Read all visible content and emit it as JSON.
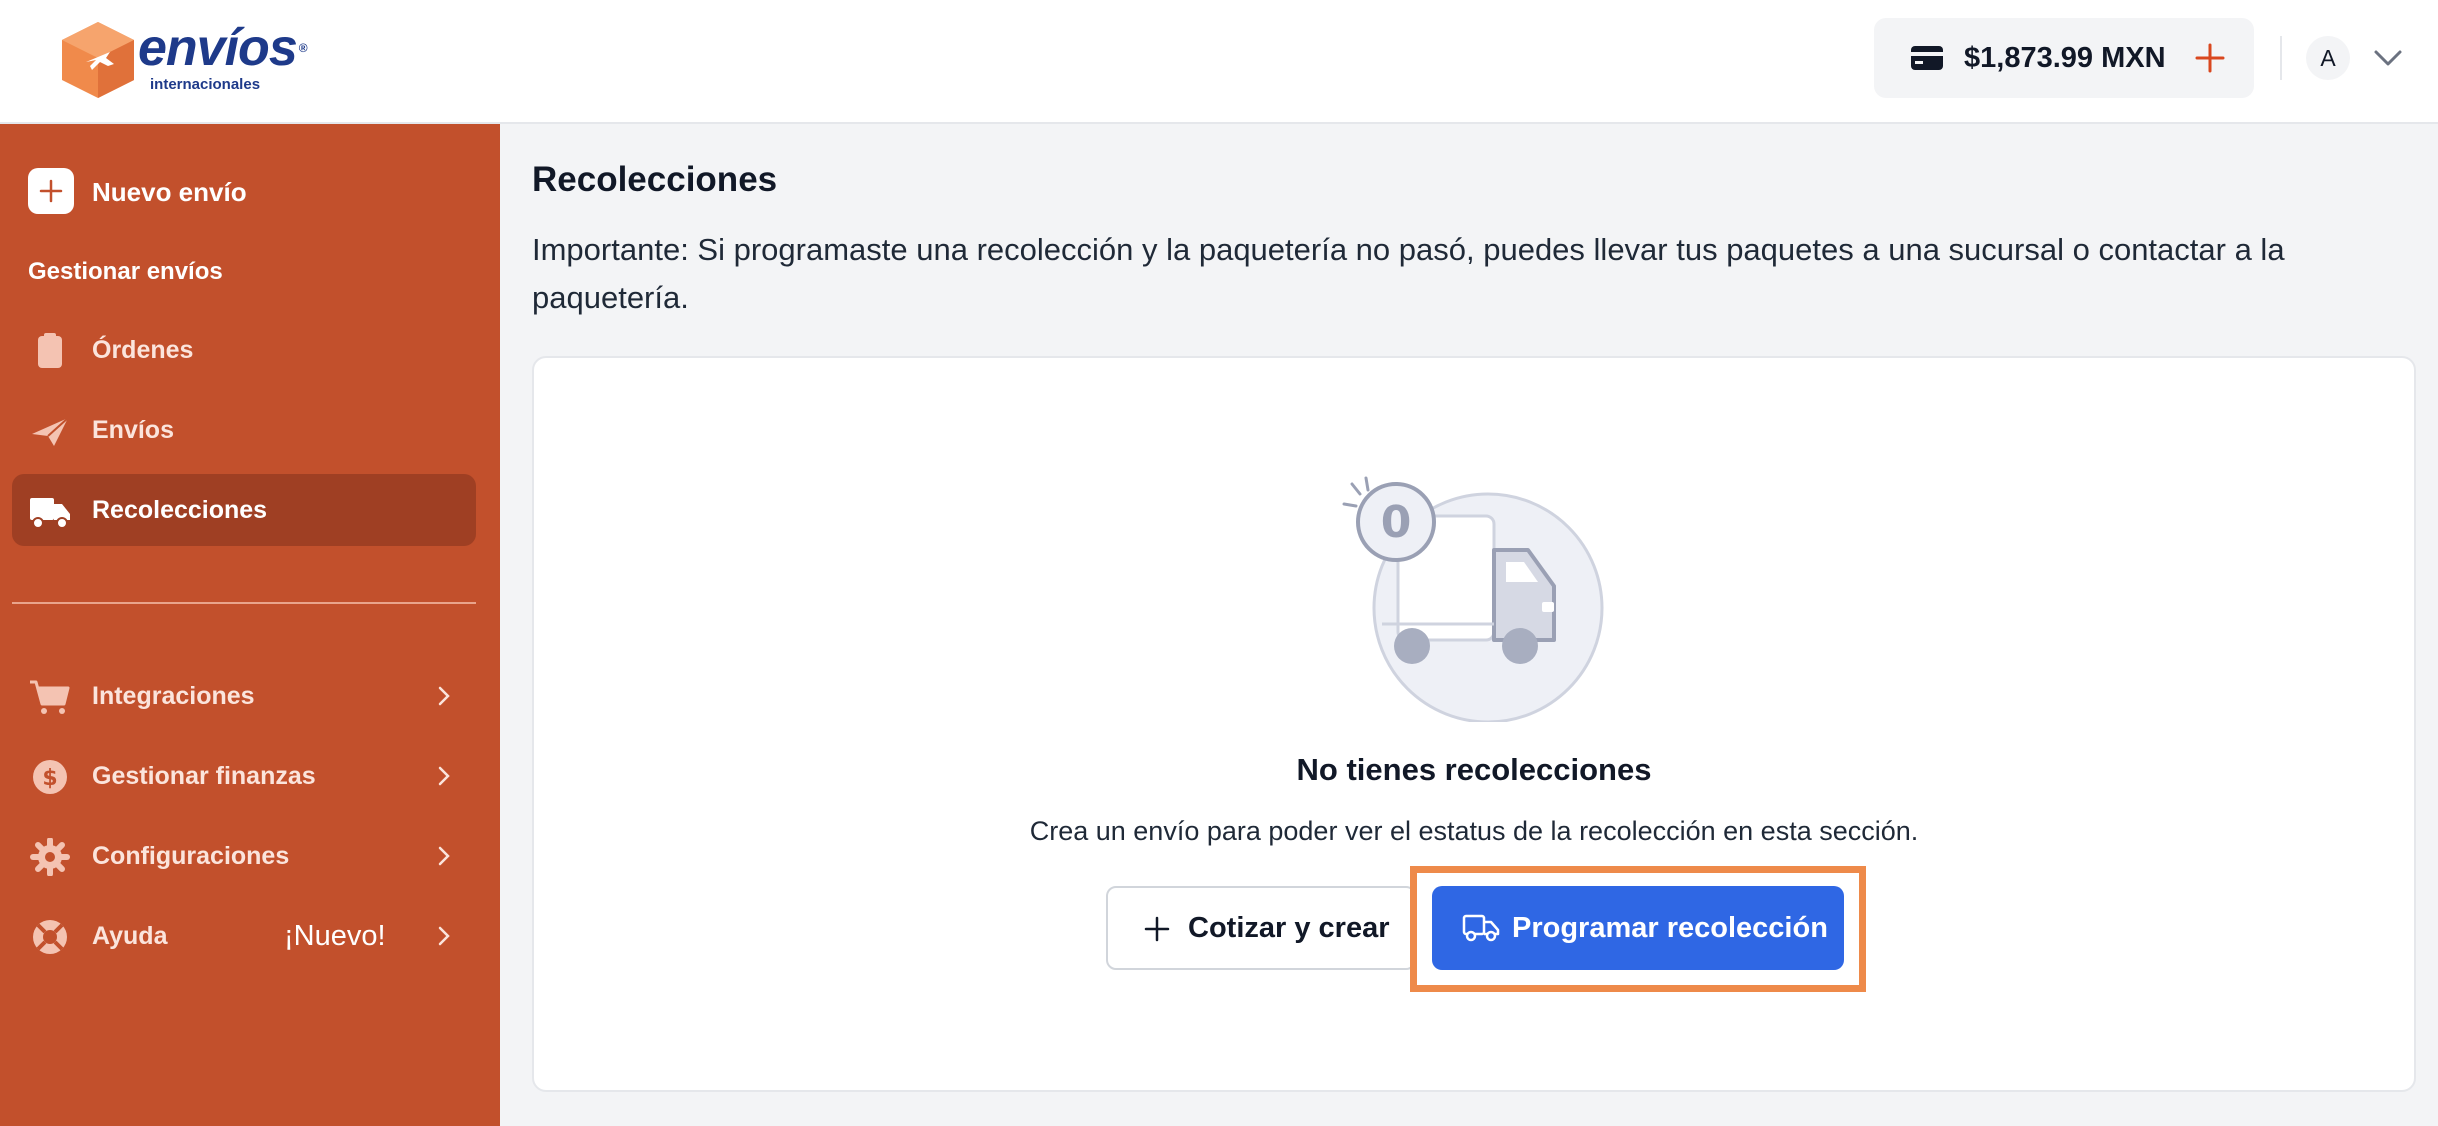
{
  "brand": {
    "name": "envíos",
    "registered_mark": "®",
    "tagline": "internacionales",
    "colors": {
      "primary_orange": "#c2502c",
      "active_orange": "#9f3f23",
      "brand_blue": "#1e3a8a",
      "action_blue": "#2f67e4",
      "highlight": "#ee8a4a"
    }
  },
  "header": {
    "balance": "$1,873.99 MXN",
    "balance_icon": "credit-card-icon",
    "add_funds_icon": "plus-icon",
    "avatar_initial": "A",
    "user_menu_icon": "chevron-down-icon"
  },
  "sidebar": {
    "new_shipment": {
      "label": "Nuevo envío",
      "icon": "plus-icon"
    },
    "section_title": "Gestionar envíos",
    "items": [
      {
        "label": "Órdenes",
        "icon": "clipboard-icon",
        "active": false
      },
      {
        "label": "Envíos",
        "icon": "paper-plane-icon",
        "active": false
      },
      {
        "label": "Recolecciones",
        "icon": "truck-icon",
        "active": true
      }
    ],
    "secondary_items": [
      {
        "label": "Integraciones",
        "icon": "shopping-cart-icon",
        "badge": ""
      },
      {
        "label": "Gestionar finanzas",
        "icon": "dollar-circle-icon",
        "badge": ""
      },
      {
        "label": "Configuraciones",
        "icon": "gear-icon",
        "badge": ""
      },
      {
        "label": "Ayuda",
        "icon": "lifebuoy-icon",
        "badge": "¡Nuevo!"
      }
    ]
  },
  "main": {
    "title": "Recolecciones",
    "notice": "Importante: Si programaste una recolección y la paquetería no pasó, puedes llevar tus paquetes a una sucursal o contactar a la paquetería.",
    "empty_state": {
      "illustration": "empty-truck-illustration",
      "count": "0",
      "title": "No tienes recolecciones",
      "description": "Crea un envío para poder ver el estatus de la recolección en esta sección.",
      "secondary_button": "Cotizar y crear",
      "primary_button": "Programar recolección"
    }
  }
}
